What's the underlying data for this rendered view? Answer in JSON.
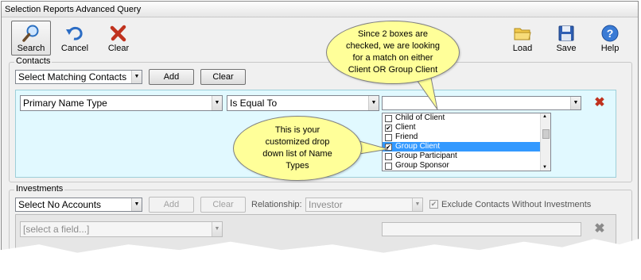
{
  "window": {
    "title": "Selection Reports Advanced Query"
  },
  "toolbar": {
    "search": {
      "label": "Search",
      "icon": "magnifier-icon"
    },
    "cancel": {
      "label": "Cancel",
      "icon": "undo-arrow-icon"
    },
    "clear": {
      "label": "Clear",
      "icon": "red-x-icon"
    },
    "load": {
      "label": "Load",
      "icon": "folder-icon"
    },
    "save": {
      "label": "Save",
      "icon": "floppy-disk-icon"
    },
    "help": {
      "label": "Help",
      "icon": "question-circle-icon"
    }
  },
  "contacts": {
    "legend": "Contacts",
    "match_select": "Select Matching Contacts",
    "add_label": "Add",
    "clear_label": "Clear",
    "field_select": "Primary Name Type",
    "operator_select": "Is Equal To",
    "value_select": "",
    "name_types": [
      {
        "label": "Child of Client",
        "checked": false,
        "selected": false
      },
      {
        "label": "Client",
        "checked": true,
        "selected": false
      },
      {
        "label": "Friend",
        "checked": false,
        "selected": false
      },
      {
        "label": "Group Client",
        "checked": true,
        "selected": true
      },
      {
        "label": "Group Participant",
        "checked": false,
        "selected": false
      },
      {
        "label": "Group Sponsor",
        "checked": false,
        "selected": false
      }
    ]
  },
  "callouts": {
    "top": [
      "Since 2 boxes are",
      "checked, we are looking",
      "for a match on either",
      "Client OR Group Client"
    ],
    "left": [
      "This is your",
      "customized drop",
      "down list of Name",
      "Types"
    ]
  },
  "investments": {
    "legend": "Investments",
    "accounts_select": "Select No Accounts",
    "add_label": "Add",
    "clear_label": "Clear",
    "relationship_label": "Relationship:",
    "relationship_value": "Investor",
    "exclude_label": "Exclude Contacts Without Investments",
    "exclude_checked": true,
    "field_placeholder": "[select a field...]"
  },
  "colors": {
    "callout_fill": "#ffff99",
    "contacts_panel": "#e1f9ff",
    "selection_highlight": "#3399ff",
    "delete_red": "#c0321e"
  }
}
